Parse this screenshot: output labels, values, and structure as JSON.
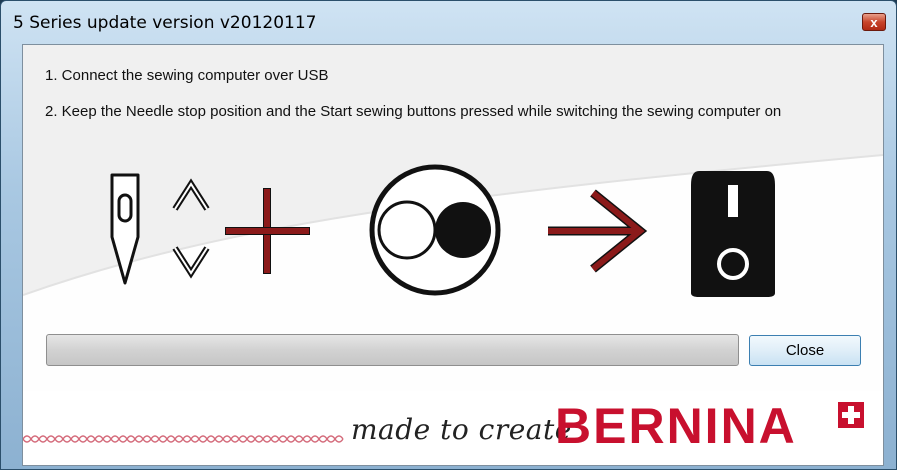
{
  "window": {
    "title": "5 Series update version v20120117",
    "close_glyph": "x"
  },
  "instructions": {
    "step1": "1. Connect the sewing computer over USB",
    "step2": "2. Keep the Needle stop position and the Start sewing buttons pressed while switching the sewing computer on"
  },
  "illustration": {
    "icons": [
      "needle-icon",
      "up-down-arrows-icon",
      "plus-icon",
      "start-stop-buttons-icon",
      "arrow-right-icon",
      "power-switch-icon"
    ]
  },
  "progress": {
    "value": 0
  },
  "buttons": {
    "close_label": "Close"
  },
  "footer": {
    "tagline": "made to create",
    "brand": "BERNINA"
  },
  "colors": {
    "accent_red": "#8b1a1a",
    "brand_red": "#c8102e"
  }
}
